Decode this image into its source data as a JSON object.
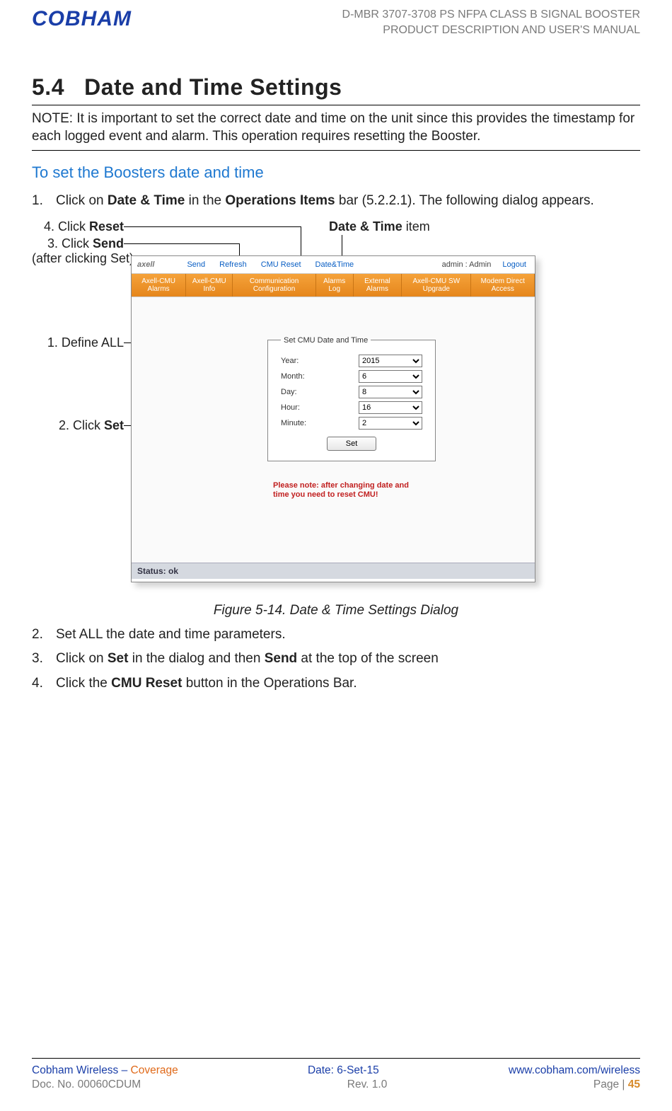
{
  "header": {
    "logo_text": "COBHAM",
    "doc_line1": "D-MBR 3707-3708 PS NFPA CLASS B SIGNAL BOOSTER",
    "doc_line2": "PRODUCT DESCRIPTION AND USER'S MANUAL"
  },
  "section": {
    "number": "5.4",
    "title": "Date and Time Settings",
    "note": "NOTE: It is important to set the correct date and time on the unit since this provides the timestamp for each logged event and alarm.  This operation requires resetting the Booster.",
    "subheading": "To set the Boosters date and time",
    "steps": {
      "s1_num": "1.",
      "s1a": "Click on ",
      "s1b": "Date & Time",
      "s1c": " in the ",
      "s1d": "Operations Items",
      "s1e": " bar (5.2.2.1).  The following dialog appears.",
      "s2_num": "2.",
      "s2": "Set ALL the date and time parameters.",
      "s3_num": "3.",
      "s3a": "Click on ",
      "s3b": "Set",
      "s3c": " in the dialog and then ",
      "s3d": "Send",
      "s3e": " at the top of the screen",
      "s4_num": "4.",
      "s4a": "Click the ",
      "s4b": "CMU Reset",
      "s4c": " button in the Operations Bar."
    },
    "figure_caption": "Figure 5-14. Date & Time Settings Dialog"
  },
  "callouts": {
    "top_right_a": "Date & Time",
    "top_right_b": " item",
    "reset_a": "4. Click ",
    "reset_b": "Reset",
    "send_a": "3. Click ",
    "send_b": "Send",
    "send_c": "(after clicking Set)",
    "define": "1. Define ALL",
    "set_a": "2. Click ",
    "set_b": "Set"
  },
  "screenshot": {
    "brand": "axell",
    "links": {
      "send": "Send",
      "refresh": "Refresh",
      "cmu_reset": "CMU Reset",
      "date_time": "Date&Time",
      "logout": "Logout"
    },
    "admin_label": "admin : Admin",
    "tabs": [
      "Axell-CMU Alarms",
      "Axell-CMU Info",
      "Communication Configuration",
      "Alarms Log",
      "External Alarms",
      "Axell-CMU SW Upgrade",
      "Modem Direct Access"
    ],
    "legend": "Set CMU Date and Time",
    "fields": {
      "year_label": "Year:",
      "year_value": "2015",
      "month_label": "Month:",
      "month_value": "6",
      "day_label": "Day:",
      "day_value": "8",
      "hour_label": "Hour:",
      "hour_value": "16",
      "minute_label": "Minute:",
      "minute_value": "2"
    },
    "set_button": "Set",
    "warning": "Please note: after changing date and time you need to reset CMU!",
    "status": "Status: ok"
  },
  "footer": {
    "l1_left_a": "Cobham Wireless",
    "l1_left_b": " – ",
    "l1_left_c": "Coverage",
    "l1_mid": "Date: 6-Set-15",
    "l1_right": "www.cobham.com/wireless",
    "l2_left": "Doc. No. 00060CDUM",
    "l2_mid": "Rev. 1.0",
    "l2_right_a": "Page | ",
    "l2_right_b": "45"
  }
}
